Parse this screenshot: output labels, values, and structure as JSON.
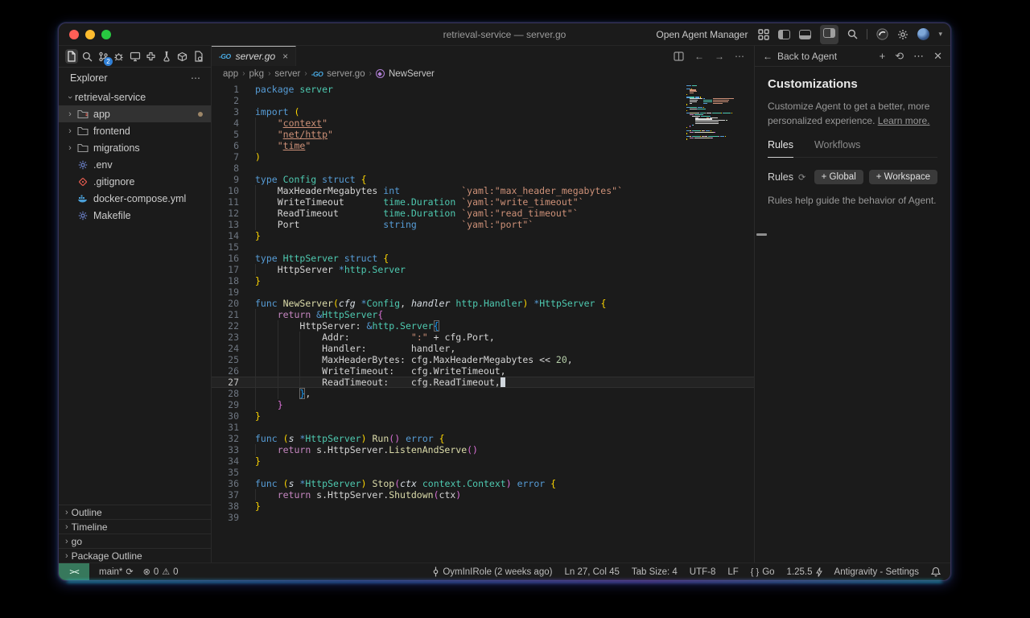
{
  "window": {
    "title": "retrieval-service — server.go"
  },
  "titlebar": {
    "open_agent_manager": "Open Agent Manager"
  },
  "activity": {
    "scm_badge": "2",
    "icons": [
      "explorer",
      "search",
      "source-control",
      "debug",
      "remote-explorer",
      "extensions",
      "testing",
      "containers",
      "settings-file"
    ]
  },
  "explorer": {
    "header": "Explorer",
    "items": [
      {
        "type": "root",
        "label": "retrieval-service"
      },
      {
        "type": "folder",
        "label": "app",
        "selected": true,
        "modified": true
      },
      {
        "type": "folder",
        "label": "frontend"
      },
      {
        "type": "folder",
        "label": "migrations"
      },
      {
        "type": "file",
        "icon": "gear",
        "label": ".env"
      },
      {
        "type": "file",
        "icon": "git",
        "label": ".gitignore"
      },
      {
        "type": "file",
        "icon": "docker",
        "label": "docker-compose.yml"
      },
      {
        "type": "file",
        "icon": "gear",
        "label": "Makefile"
      }
    ],
    "bottom_sections": [
      "Outline",
      "Timeline",
      "go",
      "Package Outline"
    ]
  },
  "tab": {
    "label": "server.go",
    "close": "×"
  },
  "breadcrumbs": {
    "items": [
      {
        "label": "app"
      },
      {
        "label": "pkg"
      },
      {
        "label": "server"
      },
      {
        "label": "server.go",
        "icon": "go"
      },
      {
        "label": "NewServer",
        "icon": "symbol"
      }
    ]
  },
  "editor": {
    "current_line": 27,
    "lines": [
      {
        "n": 1,
        "tokens": [
          [
            "k",
            "package "
          ],
          [
            "t",
            "server"
          ]
        ]
      },
      {
        "n": 2,
        "tokens": []
      },
      {
        "n": 3,
        "tokens": [
          [
            "k",
            "import "
          ],
          [
            "b1",
            "("
          ]
        ]
      },
      {
        "n": 4,
        "tokens": [
          [
            "p",
            "    "
          ],
          [
            "s",
            "\""
          ],
          [
            "u",
            "context"
          ],
          [
            "s",
            "\""
          ]
        ]
      },
      {
        "n": 5,
        "tokens": [
          [
            "p",
            "    "
          ],
          [
            "s",
            "\""
          ],
          [
            "u",
            "net/http"
          ],
          [
            "s",
            "\""
          ]
        ]
      },
      {
        "n": 6,
        "tokens": [
          [
            "p",
            "    "
          ],
          [
            "s",
            "\""
          ],
          [
            "u",
            "time"
          ],
          [
            "s",
            "\""
          ]
        ]
      },
      {
        "n": 7,
        "tokens": [
          [
            "b1",
            ")"
          ]
        ]
      },
      {
        "n": 8,
        "tokens": []
      },
      {
        "n": 9,
        "tokens": [
          [
            "k",
            "type "
          ],
          [
            "t",
            "Config "
          ],
          [
            "k",
            "struct "
          ],
          [
            "b1",
            "{"
          ]
        ]
      },
      {
        "n": 10,
        "tokens": [
          [
            "p",
            "    MaxHeaderMegabytes "
          ],
          [
            "k",
            "int"
          ],
          [
            "p",
            "           "
          ],
          [
            "s",
            "`yaml:\"max_header_megabytes\"`"
          ]
        ]
      },
      {
        "n": 11,
        "tokens": [
          [
            "p",
            "    WriteTimeout       "
          ],
          [
            "t",
            "time.Duration"
          ],
          [
            "p",
            " "
          ],
          [
            "s",
            "`yaml:\"write_timeout\"`"
          ]
        ]
      },
      {
        "n": 12,
        "tokens": [
          [
            "p",
            "    ReadTimeout        "
          ],
          [
            "t",
            "time.Duration"
          ],
          [
            "p",
            " "
          ],
          [
            "s",
            "`yaml:\"read_timeout\"`"
          ]
        ]
      },
      {
        "n": 13,
        "tokens": [
          [
            "p",
            "    Port               "
          ],
          [
            "k",
            "string"
          ],
          [
            "p",
            "        "
          ],
          [
            "s",
            "`yaml:\"port\"`"
          ]
        ]
      },
      {
        "n": 14,
        "tokens": [
          [
            "b1",
            "}"
          ]
        ]
      },
      {
        "n": 15,
        "tokens": []
      },
      {
        "n": 16,
        "tokens": [
          [
            "k",
            "type "
          ],
          [
            "t",
            "HttpServer "
          ],
          [
            "k",
            "struct "
          ],
          [
            "b1",
            "{"
          ]
        ]
      },
      {
        "n": 17,
        "tokens": [
          [
            "p",
            "    HttpServer "
          ],
          [
            "k",
            "*"
          ],
          [
            "t",
            "http.Server"
          ]
        ]
      },
      {
        "n": 18,
        "tokens": [
          [
            "b1",
            "}"
          ]
        ]
      },
      {
        "n": 19,
        "tokens": []
      },
      {
        "n": 20,
        "tokens": [
          [
            "k",
            "func "
          ],
          [
            "f",
            "NewServer"
          ],
          [
            "b1",
            "("
          ],
          [
            "i",
            "cfg"
          ],
          [
            "p",
            " "
          ],
          [
            "k",
            "*"
          ],
          [
            "t",
            "Config"
          ],
          [
            "p",
            ", "
          ],
          [
            "i",
            "handler"
          ],
          [
            "p",
            " "
          ],
          [
            "t",
            "http.Handler"
          ],
          [
            "b1",
            ")"
          ],
          [
            "p",
            " "
          ],
          [
            "k",
            "*"
          ],
          [
            "t",
            "HttpServer"
          ],
          [
            "p",
            " "
          ],
          [
            "b1",
            "{"
          ]
        ]
      },
      {
        "n": 21,
        "tokens": [
          [
            "p",
            "    "
          ],
          [
            "c",
            "return "
          ],
          [
            "k",
            "&"
          ],
          [
            "t",
            "HttpServer"
          ],
          [
            "b2",
            "{"
          ]
        ]
      },
      {
        "n": 22,
        "tokens": [
          [
            "p",
            "        HttpServer: "
          ],
          [
            "k",
            "&"
          ],
          [
            "t",
            "http.Server"
          ],
          [
            "b3m",
            "{"
          ]
        ]
      },
      {
        "n": 23,
        "tokens": [
          [
            "p",
            "            Addr:           "
          ],
          [
            "s",
            "\":\""
          ],
          [
            "p",
            " + cfg.Port,"
          ]
        ]
      },
      {
        "n": 24,
        "tokens": [
          [
            "p",
            "            Handler:        handler,"
          ]
        ]
      },
      {
        "n": 25,
        "tokens": [
          [
            "p",
            "            MaxHeaderBytes: cfg.MaxHeaderMegabytes << "
          ],
          [
            "n",
            "20"
          ],
          [
            "p",
            ","
          ]
        ]
      },
      {
        "n": 26,
        "tokens": [
          [
            "p",
            "            WriteTimeout:   cfg.WriteTimeout,"
          ]
        ]
      },
      {
        "n": 27,
        "tokens": [
          [
            "p",
            "            ReadTimeout:    cfg.ReadTimeout,"
          ]
        ],
        "cursor": true
      },
      {
        "n": 28,
        "tokens": [
          [
            "p",
            "        "
          ],
          [
            "b3m",
            "}"
          ],
          [
            "p",
            ","
          ]
        ]
      },
      {
        "n": 29,
        "tokens": [
          [
            "p",
            "    "
          ],
          [
            "b2",
            "}"
          ]
        ]
      },
      {
        "n": 30,
        "tokens": [
          [
            "b1",
            "}"
          ]
        ]
      },
      {
        "n": 31,
        "tokens": []
      },
      {
        "n": 32,
        "tokens": [
          [
            "k",
            "func "
          ],
          [
            "b1",
            "("
          ],
          [
            "i",
            "s"
          ],
          [
            "p",
            " "
          ],
          [
            "k",
            "*"
          ],
          [
            "t",
            "HttpServer"
          ],
          [
            "b1",
            ") "
          ],
          [
            "f",
            "Run"
          ],
          [
            "b2",
            "()"
          ],
          [
            "p",
            " "
          ],
          [
            "k",
            "error"
          ],
          [
            "p",
            " "
          ],
          [
            "b1",
            "{"
          ]
        ]
      },
      {
        "n": 33,
        "tokens": [
          [
            "p",
            "    "
          ],
          [
            "c",
            "return "
          ],
          [
            "p",
            "s.HttpServer."
          ],
          [
            "f",
            "ListenAndServe"
          ],
          [
            "b2",
            "()"
          ]
        ]
      },
      {
        "n": 34,
        "tokens": [
          [
            "b1",
            "}"
          ]
        ]
      },
      {
        "n": 35,
        "tokens": []
      },
      {
        "n": 36,
        "tokens": [
          [
            "k",
            "func "
          ],
          [
            "b1",
            "("
          ],
          [
            "i",
            "s"
          ],
          [
            "p",
            " "
          ],
          [
            "k",
            "*"
          ],
          [
            "t",
            "HttpServer"
          ],
          [
            "b1",
            ") "
          ],
          [
            "f",
            "Stop"
          ],
          [
            "b2",
            "("
          ],
          [
            "i",
            "ctx"
          ],
          [
            "p",
            " "
          ],
          [
            "t",
            "context.Context"
          ],
          [
            "b2",
            ")"
          ],
          [
            "p",
            " "
          ],
          [
            "k",
            "error"
          ],
          [
            "p",
            " "
          ],
          [
            "b1",
            "{"
          ]
        ]
      },
      {
        "n": 37,
        "tokens": [
          [
            "p",
            "    "
          ],
          [
            "c",
            "return "
          ],
          [
            "p",
            "s.HttpServer."
          ],
          [
            "f",
            "Shutdown"
          ],
          [
            "b2",
            "("
          ],
          [
            "p",
            "ctx"
          ],
          [
            "b2",
            ")"
          ]
        ]
      },
      {
        "n": 38,
        "tokens": [
          [
            "b1",
            "}"
          ]
        ]
      },
      {
        "n": 39,
        "tokens": []
      }
    ]
  },
  "panel": {
    "back": "Back to Agent",
    "title": "Customizations",
    "desc": "Customize Agent to get a better, more personalized experience. ",
    "learn_more": "Learn more.",
    "tabs": [
      {
        "label": "Rules",
        "active": true
      },
      {
        "label": "Workflows",
        "active": false
      }
    ],
    "section_title": "Rules",
    "buttons": [
      "+ Global",
      "+ Workspace"
    ],
    "hint": "Rules help guide the behavior of Agent."
  },
  "statusbar": {
    "remote_label": "><",
    "branch": "main*",
    "errors": "0",
    "warnings": "0",
    "blame": "OymInIRole (2 weeks ago)",
    "cursor_position": "Ln 27, Col 45",
    "tab_size": "Tab Size: 4",
    "encoding": "UTF-8",
    "eol": "LF",
    "language": "Go",
    "go_version": "1.25.5",
    "settings": "Antigravity - Settings"
  },
  "colors": {
    "accent_green": "#37785c",
    "badge_blue": "#2f7fd6",
    "window_bg": "#1b1b1b"
  }
}
